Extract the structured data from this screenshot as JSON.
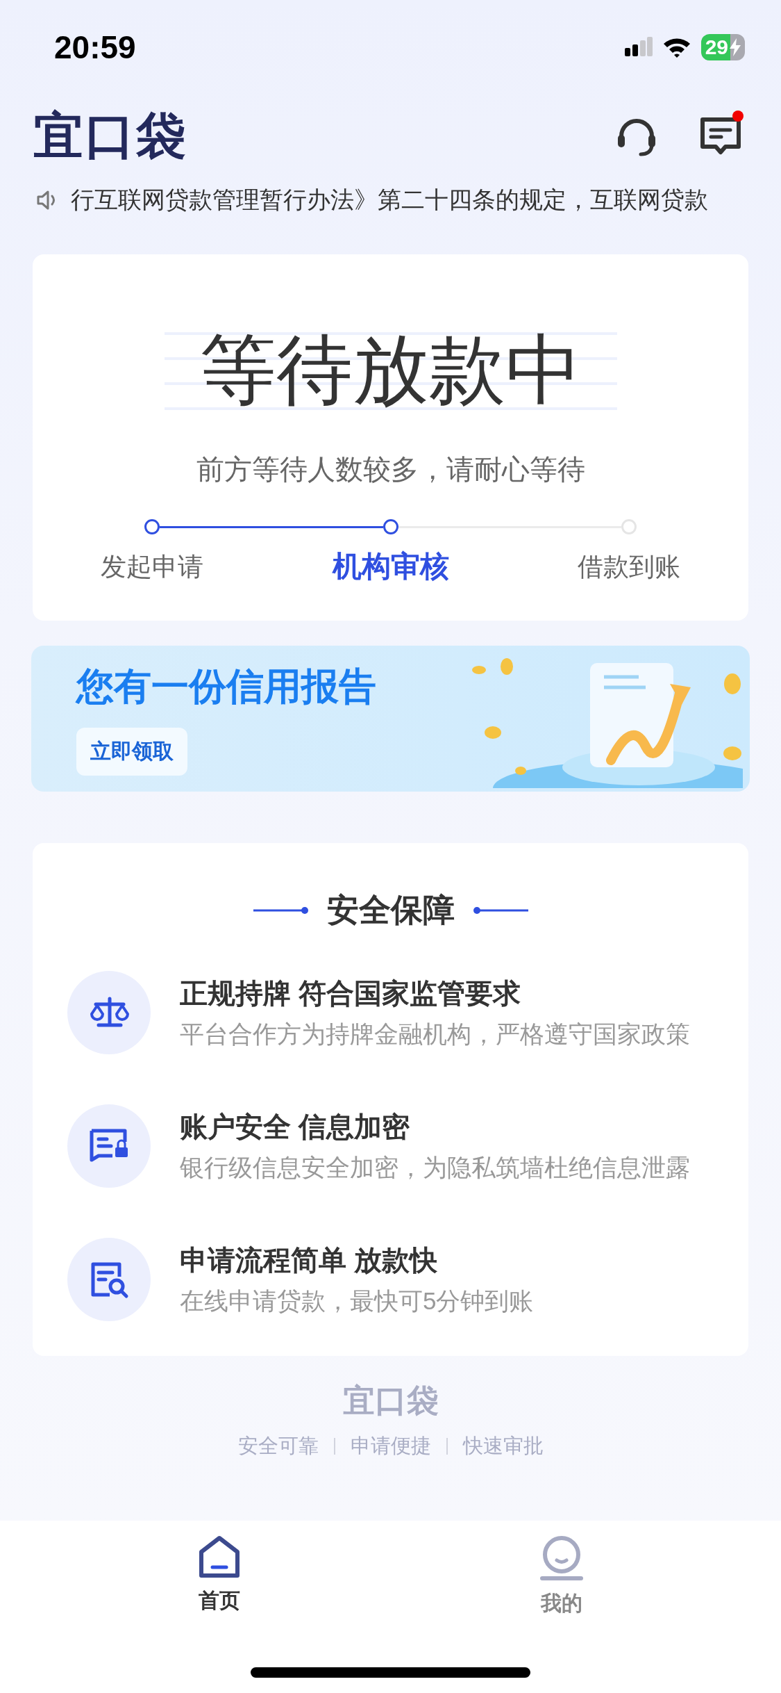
{
  "status_bar": {
    "time": "20:59",
    "battery": "29"
  },
  "header": {
    "logo": "宜口袋",
    "messages_unread": true
  },
  "notice": {
    "text": "行互联网贷款管理暂行办法》第二十四条的规定，互联网贷款"
  },
  "status_card": {
    "title": "等待放款中",
    "subtitle": "前方等待人数较多，请耐心等待",
    "steps": [
      {
        "label": "发起申请",
        "reached": true,
        "selected": false
      },
      {
        "label": "机构审核",
        "reached": true,
        "selected": true
      },
      {
        "label": "借款到账",
        "reached": false,
        "selected": false
      }
    ]
  },
  "banner": {
    "title": "您有一份信用报告",
    "button": "立即领取"
  },
  "security": {
    "heading": "安全保障",
    "items": [
      {
        "kind": "scale",
        "title": "正规持牌 符合国家监管要求",
        "description": "平台合作方为持牌金融机构，严格遵守国家政策"
      },
      {
        "kind": "lock",
        "title": "账户安全 信息加密",
        "description": "银行级信息安全加密，为隐私筑墙杜绝信息泄露"
      },
      {
        "kind": "search",
        "title": "申请流程简单 放款快",
        "description": "在线申请贷款，最快可5分钟到账"
      }
    ]
  },
  "footer": {
    "logo": "宜口袋",
    "slogans": [
      "安全可靠",
      "申请便捷",
      "快速审批"
    ]
  },
  "tab_bar": [
    {
      "kind": "home",
      "label": "首页",
      "selected": true
    },
    {
      "kind": "profile",
      "label": "我的",
      "selected": false
    }
  ]
}
